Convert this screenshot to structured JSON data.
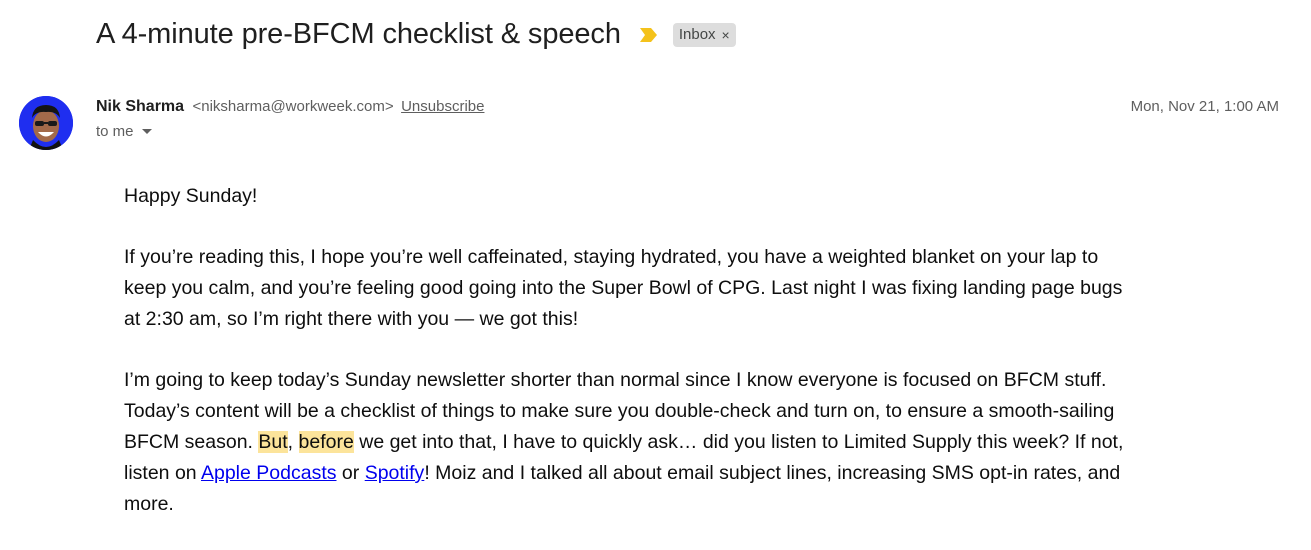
{
  "email": {
    "subject": "A 4-minute pre-BFCM checklist & speech",
    "label": "Inbox",
    "label_remove": "×",
    "importance_icon": "importance-marker-icon",
    "sender_name": "Nik Sharma",
    "sender_email": "<niksharma@workweek.com>",
    "unsubscribe": "Unsubscribe",
    "recipient": "to me",
    "date": "Mon, Nov 21, 1:00 AM",
    "colors": {
      "importance": "#f4c21b",
      "highlight": "#fce49b",
      "link": "#0000ee",
      "avatar_bg": "#1f2ef0"
    }
  },
  "body": {
    "greeting": "Happy Sunday!",
    "p1": "If you’re reading this, I hope you’re well caffeinated, staying hydrated, you have a weighted blanket on your lap to keep you calm, and you’re feeling good going into the Super Bowl of CPG. Last night I was fixing landing page bugs at 2:30 am, so I’m right there with you — we got this!",
    "p2": {
      "part1": "I’m going to keep today’s Sunday newsletter shorter than normal since I know everyone is focused on BFCM stuff. Today’s content will be a checklist of things to make sure you double-check and turn on, to ensure a smooth-sailing BFCM season. ",
      "hl1": "But",
      "comma": ", ",
      "hl2": "before",
      "part2": " we get into that, I have to quickly ask… did you listen to Limited Supply this week? If not, listen on ",
      "link1": "Apple Podcasts",
      "or": " or ",
      "link2": "Spotify",
      "part3": "! Moiz and I talked all about email subject lines, increasing SMS opt-in rates, and more."
    }
  }
}
